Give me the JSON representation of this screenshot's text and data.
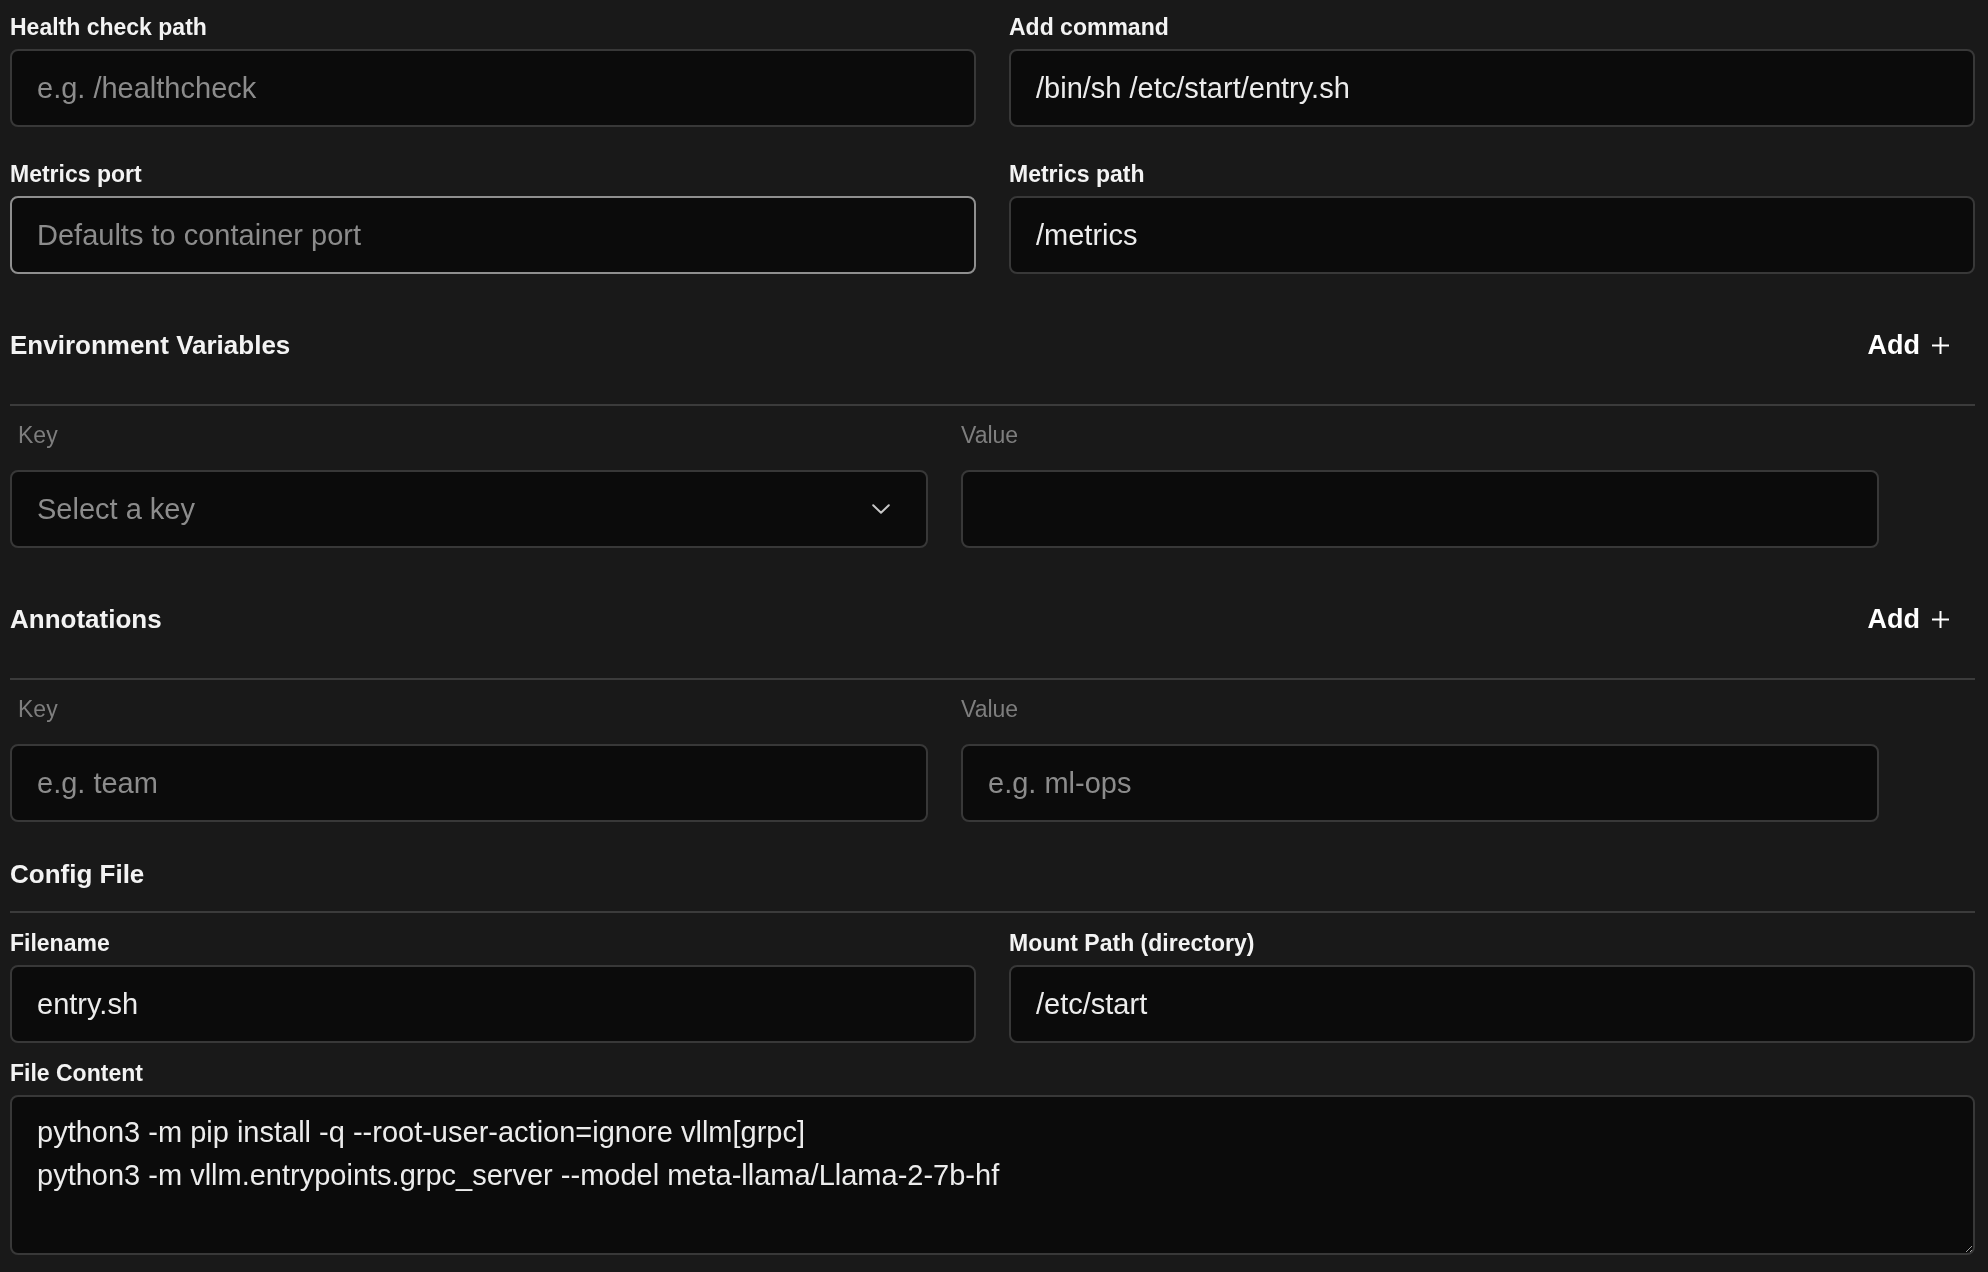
{
  "settings": {
    "fields": [
      {
        "label": "Health check path",
        "placeholder": "e.g. /healthcheck",
        "focused": false
      },
      {
        "label": "Add command",
        "value": "/bin/sh /etc/start/entry.sh",
        "focused": false
      },
      {
        "label": "Metrics port",
        "placeholder": "Defaults to container port",
        "focused": true
      },
      {
        "label": "Metrics path",
        "value": "/metrics",
        "focused": false
      }
    ]
  },
  "key_value_sections": [
    {
      "title": "Environment Variables",
      "add_button": "Add",
      "column_labels": [
        "Key",
        "Value"
      ],
      "rows": [
        {
          "key": {
            "kind": "select",
            "placeholder": "Select a key"
          }
        }
      ]
    },
    {
      "title": "Annotations",
      "add_button": "Add",
      "column_labels": [
        "Key",
        "Value"
      ],
      "rows": [
        {
          "key": {
            "kind": "input",
            "placeholder": "e.g. team"
          },
          "value": {
            "placeholder": "e.g. ml-ops"
          }
        }
      ]
    }
  ],
  "config_file": {
    "title": "Config File",
    "fields": [
      {
        "label": "Filename",
        "value": "entry.sh",
        "focused": false
      },
      {
        "label": "Mount Path (directory)",
        "value": "/etc/start",
        "focused": false
      }
    ],
    "content": {
      "label": "File Content",
      "value": "python3 -m pip install -q --root-user-action=ignore vllm[grpc]\npython3 -m vllm.entrypoints.grpc_server --model meta-llama/Llama-2-7b-hf"
    }
  }
}
